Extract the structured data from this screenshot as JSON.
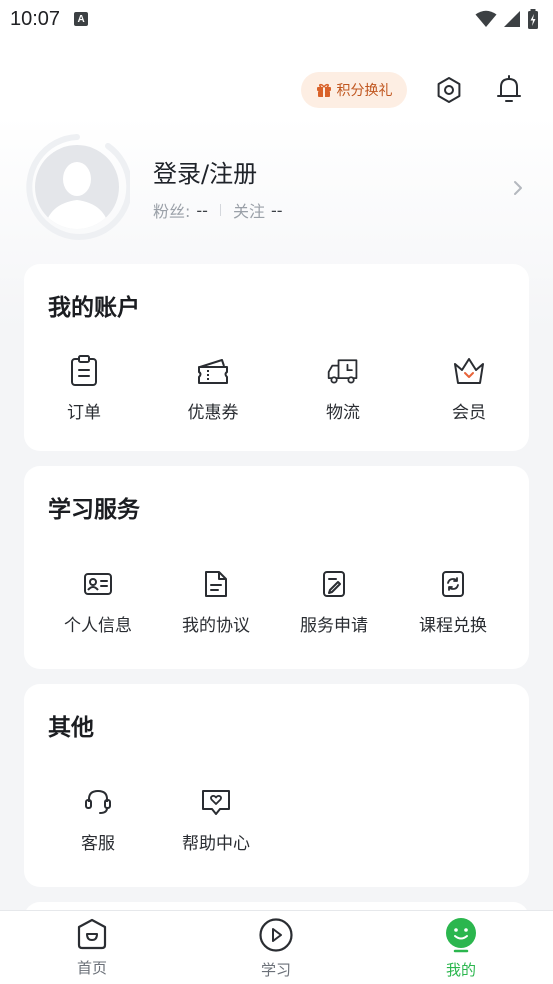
{
  "status_bar": {
    "time": "10:07",
    "notification_letter": "A"
  },
  "header": {
    "points_label": "积分换礼"
  },
  "profile": {
    "name": "登录/注册",
    "followers_label": "粉丝:",
    "followers_value": "--",
    "following_label": "关注",
    "following_value": "--"
  },
  "account": {
    "title": "我的账户",
    "items": [
      {
        "label": "订单",
        "icon": "clipboard-icon"
      },
      {
        "label": "优惠券",
        "icon": "coupon-icon"
      },
      {
        "label": "物流",
        "icon": "truck-icon"
      },
      {
        "label": "会员",
        "icon": "crown-icon"
      }
    ]
  },
  "study": {
    "title": "学习服务",
    "items": [
      {
        "label": "个人信息",
        "icon": "id-card-icon"
      },
      {
        "label": "我的协议",
        "icon": "document-icon"
      },
      {
        "label": "服务申请",
        "icon": "edit-document-icon"
      },
      {
        "label": "课程兑换",
        "icon": "exchange-icon"
      }
    ]
  },
  "other": {
    "title": "其他",
    "items": [
      {
        "label": "客服",
        "icon": "headset-icon"
      },
      {
        "label": "帮助中心",
        "icon": "help-chat-icon"
      }
    ]
  },
  "nav": {
    "items": [
      {
        "label": "首页",
        "icon": "home-icon"
      },
      {
        "label": "学习",
        "icon": "play-icon"
      },
      {
        "label": "我的",
        "icon": "smile-icon",
        "active": true
      }
    ]
  },
  "colors": {
    "accent": "#2bb64e",
    "points_bg": "#fdeee3",
    "points_text": "#c0561f"
  }
}
